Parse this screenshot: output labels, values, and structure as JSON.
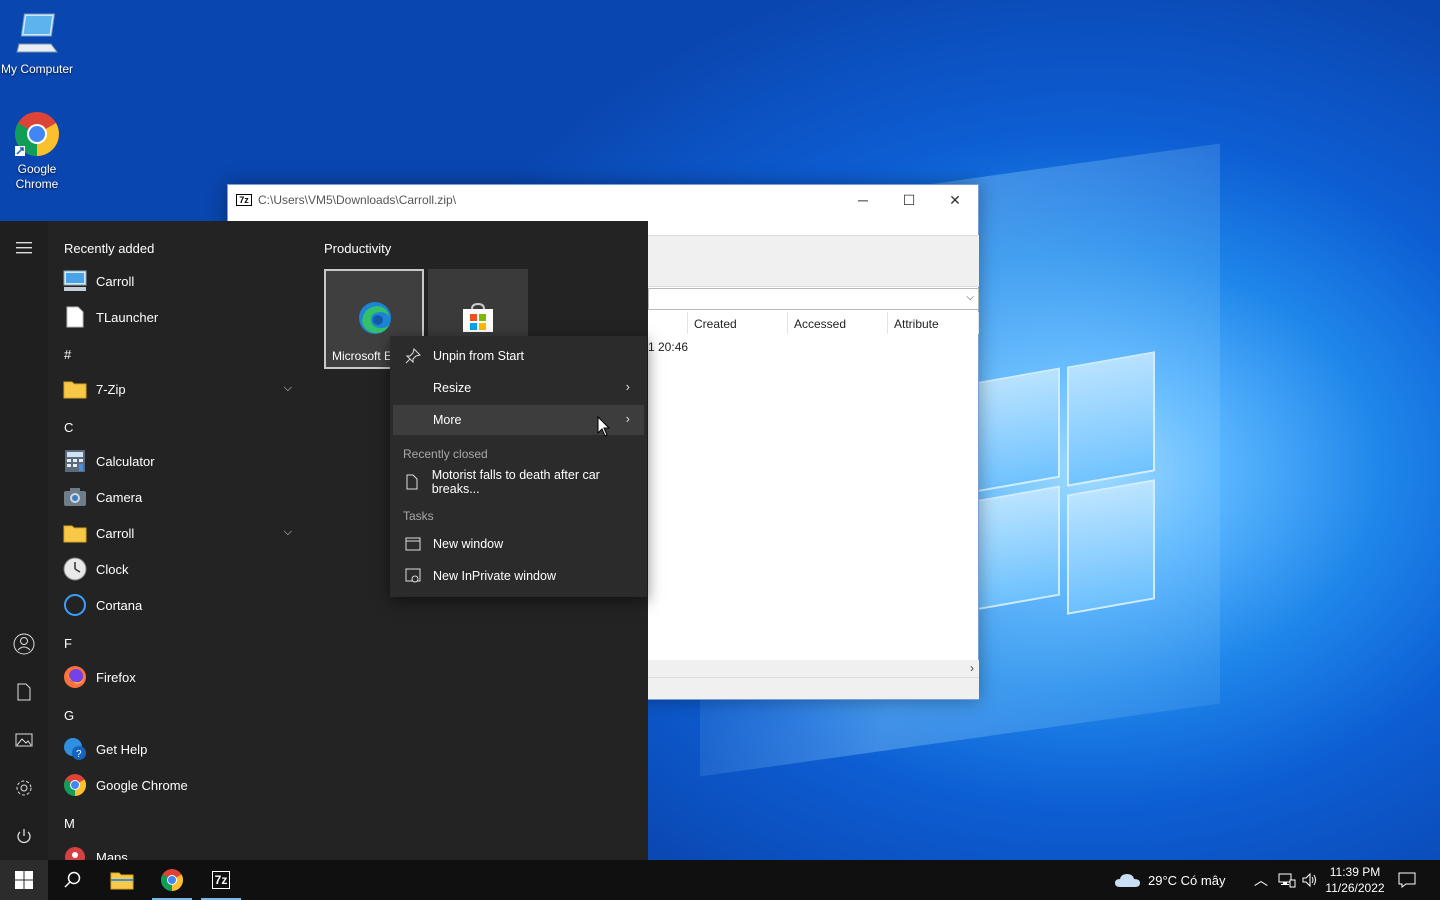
{
  "desktop": {
    "icons": [
      {
        "label": "My Computer"
      },
      {
        "label": "Google Chrome"
      }
    ]
  },
  "zip_window": {
    "title": "C:\\Users\\VM5\\Downloads\\Carroll.zip\\",
    "columns": [
      "Created",
      "Accessed",
      "Attribute"
    ],
    "row_partial": "1 20:46",
    "buttons": {
      "minimize": "─",
      "maximize": "☐",
      "close": "✕"
    }
  },
  "start_menu": {
    "recently_added_label": "Recently added",
    "recent_apps": [
      "Carroll",
      "TLauncher"
    ],
    "sections": {
      "hash": "#",
      "c": "C",
      "f": "F",
      "g": "G",
      "m": "M"
    },
    "apps": {
      "zip": "7-Zip",
      "calculator": "Calculator",
      "camera": "Camera",
      "carroll": "Carroll",
      "clock": "Clock",
      "cortana": "Cortana",
      "firefox": "Firefox",
      "gethelp": "Get Help",
      "chrome": "Google Chrome",
      "maps": "Maps"
    },
    "tiles_group": "Productivity",
    "tile_edge_label": "Microsoft E"
  },
  "context_menu": {
    "unpin": "Unpin from Start",
    "resize": "Resize",
    "more": "More",
    "recently_closed_header": "Recently closed",
    "recent_item": "Motorist falls to death after car breaks...",
    "tasks_header": "Tasks",
    "new_window": "New window",
    "new_inprivate": "New InPrivate window"
  },
  "taskbar": {
    "weather": "29°C  Có mây",
    "time": "11:39 PM",
    "date": "11/26/2022",
    "zip_icon_label": "7z"
  },
  "colors": {
    "start_bg": "#232323",
    "context_bg": "#2b2b2b",
    "taskbar_bg": "#101010",
    "accent": "#76b9ed"
  }
}
